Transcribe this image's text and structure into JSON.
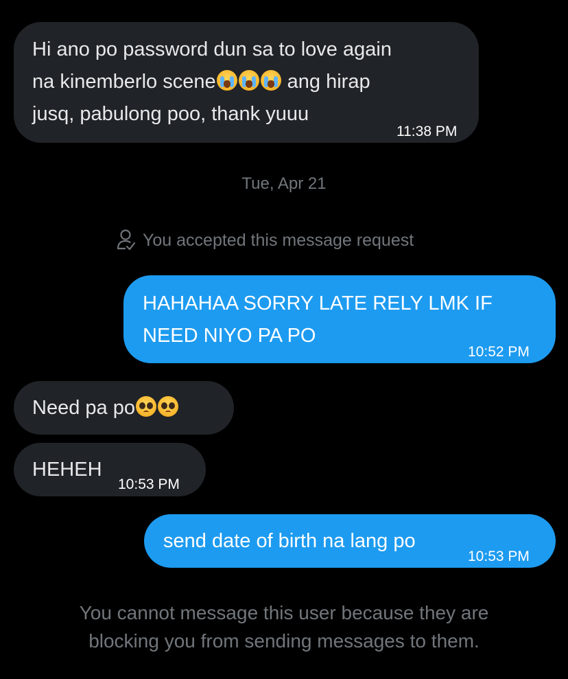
{
  "messages": {
    "m1": {
      "line1": "Hi ano po password dun sa  to love again",
      "line2_before": "na kinemberlo scene",
      "line2_after": " ang hirap",
      "line3": "jusq, pabulong poo, thank yuuu",
      "emoji_names": [
        "loudly-crying-face",
        "loudly-crying-face",
        "loudly-crying-face"
      ],
      "time": "11:38 PM"
    },
    "m2": {
      "line1": "HAHAHAA SORRY LATE RELY LMK IF",
      "line2": "NEED NIYO PA PO",
      "time": "10:52 PM"
    },
    "m3": {
      "text": "Need pa po",
      "emoji_names": [
        "pleading-face",
        "pleading-face"
      ]
    },
    "m4": {
      "text": "HEHEH",
      "time": "10:53 PM"
    },
    "m5": {
      "text": "send date of birth na lang po",
      "time": "10:53 PM"
    }
  },
  "date_separator": "Tue, Apr 21",
  "request_note": "You accepted this message request",
  "blocked_notice": {
    "line1": "You cannot message this user because they are",
    "line2": "blocking you from sending messages to them."
  },
  "colors": {
    "background": "#000000",
    "incoming_bubble": "#202327",
    "outgoing_bubble": "#1d9bf0",
    "muted_text": "#71767b"
  }
}
